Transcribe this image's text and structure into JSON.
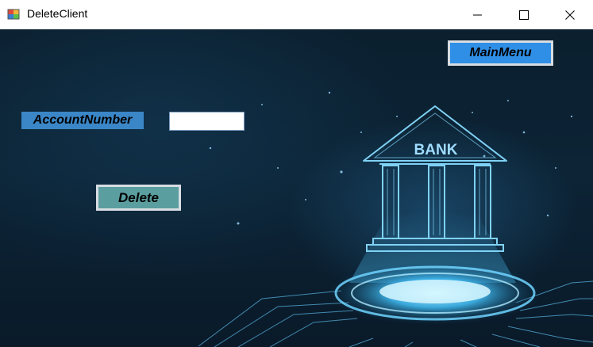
{
  "window": {
    "title": "DeleteClient",
    "minimize_icon": "minimize-icon",
    "maximize_icon": "maximize-icon",
    "close_icon": "close-icon"
  },
  "form": {
    "main_menu_label": "MainMenu",
    "account_number_label": "AccountNumber",
    "account_number_value": "",
    "delete_label": "Delete"
  },
  "background": {
    "sign_text": "BANK",
    "illustration": "bank-building-icon"
  },
  "colors": {
    "main_menu_button": "#2f8fe6",
    "account_label_bg": "#3a86c6",
    "delete_button": "#5b9ea0",
    "background_dark": "#0b1f2e",
    "glow": "#4fc3f7"
  }
}
